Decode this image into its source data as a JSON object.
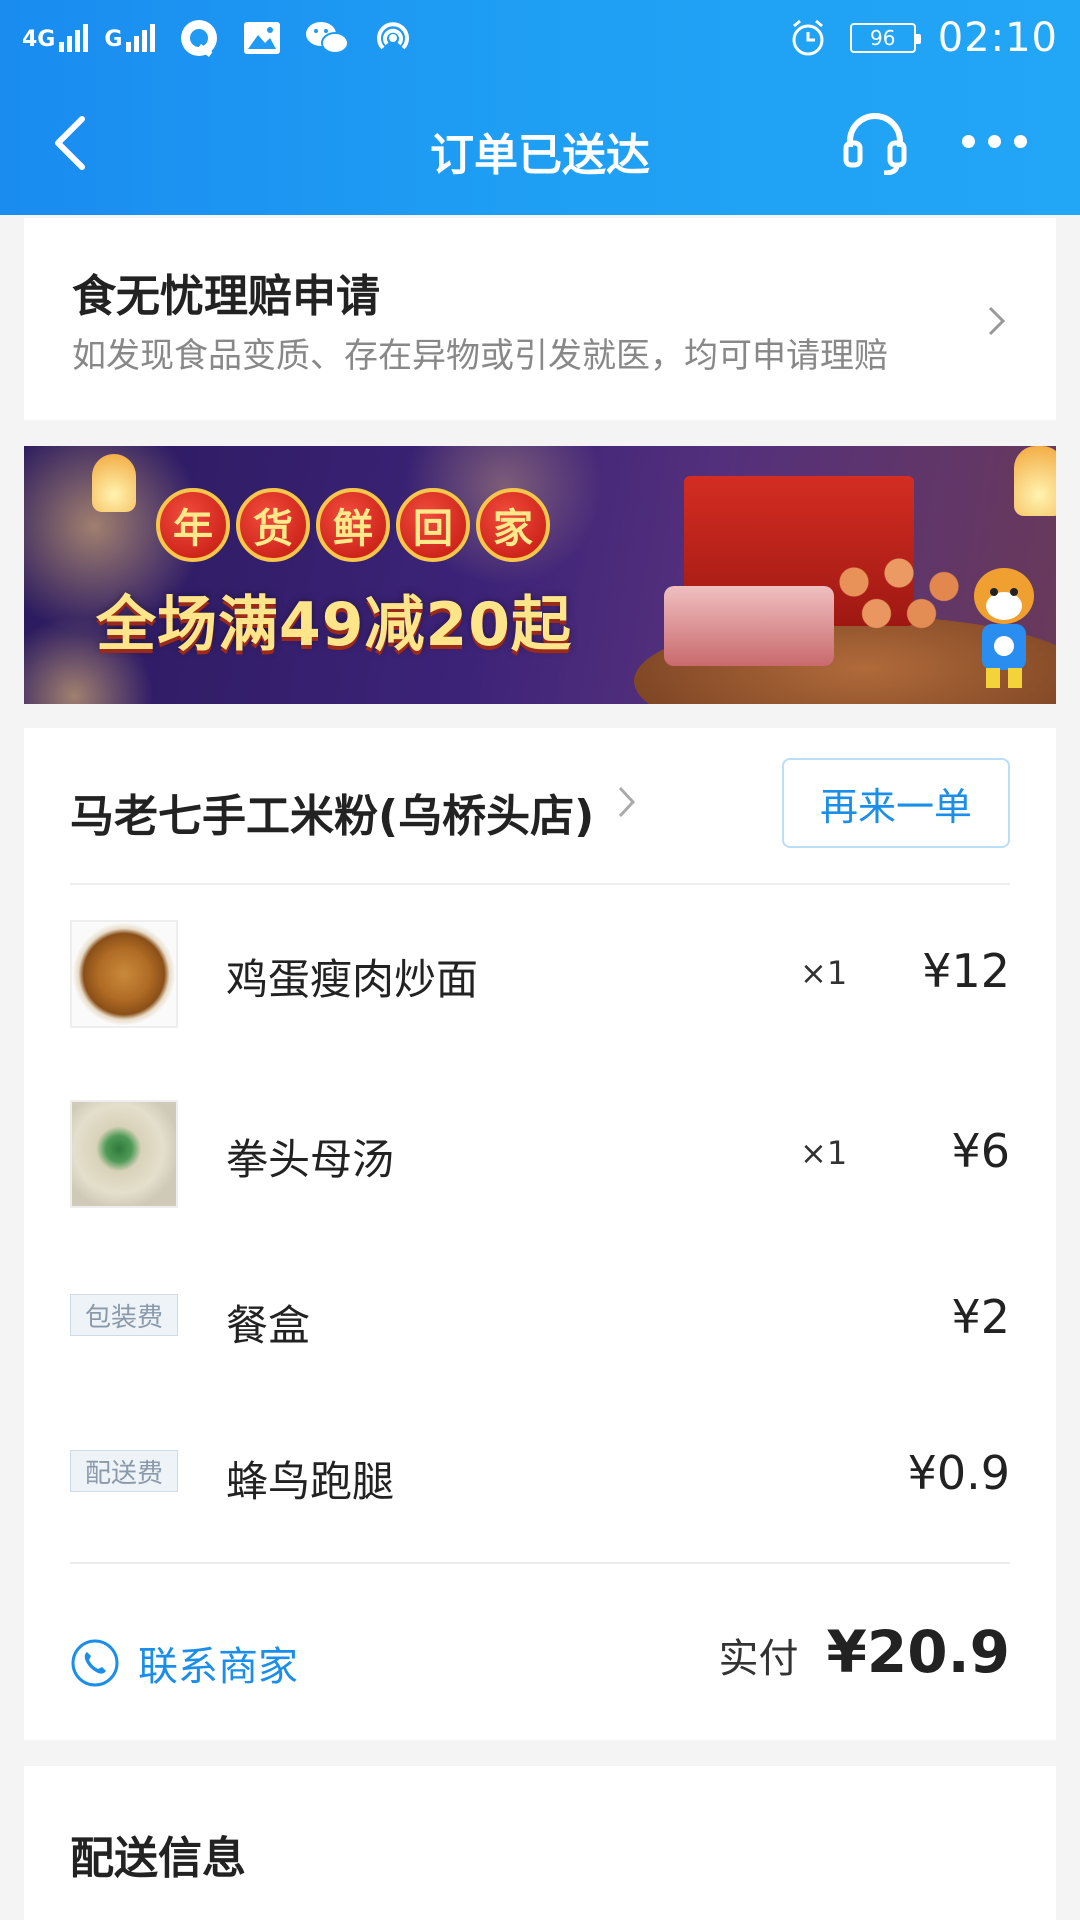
{
  "status_bar": {
    "network_1": "4G",
    "network_2": "G",
    "battery": "96",
    "time": "02:10",
    "icons": [
      "signal-icon",
      "qq-icon",
      "gallery-icon",
      "wechat-icon",
      "hotspot-icon",
      "alarm-icon",
      "battery-icon"
    ]
  },
  "nav": {
    "title": "订单已送达",
    "icons": [
      "back-icon",
      "headset-icon",
      "more-icon"
    ]
  },
  "claim": {
    "title": "食无忧理赔申请",
    "subtitle": "如发现食品变质、存在异物或引发就医，均可申请理赔"
  },
  "banner": {
    "badge_chars": [
      "年",
      "货",
      "鲜",
      "回",
      "家"
    ],
    "headline": "全场满49减20起"
  },
  "order": {
    "shop_name": "马老七手工米粉(乌桥头店)",
    "reorder_label": "再来一单",
    "items": [
      {
        "name": "鸡蛋瘦肉炒面",
        "qty": "×1",
        "price": "¥12",
        "thumb": "noodle-image"
      },
      {
        "name": "拳头母汤",
        "qty": "×1",
        "price": "¥6",
        "thumb": "soup-image"
      }
    ],
    "fees": [
      {
        "tag": "包装费",
        "name": "餐盒",
        "price": "¥2"
      },
      {
        "tag": "配送费",
        "name": "蜂鸟跑腿",
        "price": "¥0.9"
      }
    ],
    "contact_label": "联系商家",
    "paid_label": "实付",
    "paid_value": "¥20.9"
  },
  "delivery": {
    "title": "配送信息"
  },
  "colors": {
    "brand_blue": "#1a8ee8",
    "header_gradient_start": "#1a8cf0",
    "header_gradient_end": "#22a6f6"
  }
}
